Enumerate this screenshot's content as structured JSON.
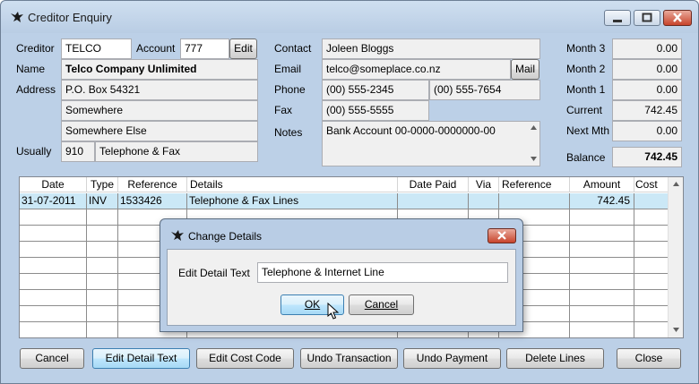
{
  "window": {
    "title": "Creditor Enquiry"
  },
  "creditor": {
    "creditor_label": "Creditor",
    "creditor_code": "TELCO",
    "account_label": "Account",
    "account_value": "777",
    "edit_button": "Edit",
    "name_label": "Name",
    "name_value": "Telco Company Unlimited",
    "address_label": "Address",
    "address_lines": [
      "P.O. Box 54321",
      "Somewhere",
      "Somewhere Else"
    ],
    "usually_label": "Usually",
    "usually_code": "910",
    "usually_text": "Telephone & Fax"
  },
  "contact": {
    "contact_label": "Contact",
    "contact_value": "Joleen Bloggs",
    "email_label": "Email",
    "email_value": "telco@someplace.co.nz",
    "mail_button": "Mail",
    "phone_label": "Phone",
    "phone_1": "(00) 555-2345",
    "phone_2": "(00) 555-7654",
    "fax_label": "Fax",
    "fax_value": "(00) 555-5555",
    "notes_label": "Notes",
    "notes_value": "Bank Account 00-0000-0000000-00"
  },
  "balances": {
    "month3_label": "Month 3",
    "month3_value": "0.00",
    "month2_label": "Month 2",
    "month2_value": "0.00",
    "month1_label": "Month 1",
    "month1_value": "0.00",
    "current_label": "Current",
    "current_value": "742.45",
    "nextmth_label": "Next Mth",
    "nextmth_value": "0.00",
    "balance_label": "Balance",
    "balance_value": "742.45"
  },
  "grid": {
    "columns": [
      "Date",
      "Type",
      "Reference",
      "Details",
      "Date Paid",
      "Via",
      "Reference",
      "Amount",
      "Cost"
    ],
    "rows": [
      {
        "date": "31-07-2011",
        "type": "INV",
        "reference": "1533426",
        "details": "Telephone & Fax Lines",
        "date_paid": "",
        "via": "",
        "reference2": "",
        "amount": "742.45",
        "cost": ""
      }
    ]
  },
  "buttons": {
    "cancel": "Cancel",
    "edit_detail_text": "Edit Detail Text",
    "edit_cost_code": "Edit Cost Code",
    "undo_transaction": "Undo Transaction",
    "undo_payment": "Undo Payment",
    "delete_lines": "Delete Lines",
    "close": "Close"
  },
  "dialog": {
    "title": "Change Details",
    "field_label": "Edit Detail Text",
    "field_value": "Telephone & Internet Line",
    "ok": "OK",
    "cancel": "Cancel"
  },
  "colors": {
    "title_bar": "#bcd0e7",
    "selection": "#cbe8f6",
    "close_button": "#c8442c"
  },
  "icons": [
    "app-bird-icon",
    "minimize-icon",
    "maximize-icon",
    "close-icon",
    "scroll-up-icon",
    "scroll-down-icon",
    "mouse-cursor-icon"
  ]
}
